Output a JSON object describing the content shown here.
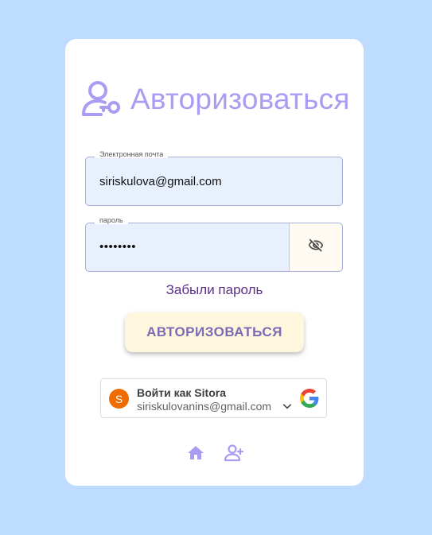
{
  "colors": {
    "page_background": "#bedcff",
    "card_background": "#ffffff",
    "accent": "#a89df3",
    "input_fill": "#e8f0fe",
    "button_fill": "#fff6de",
    "button_text": "#7a6bb5",
    "link_text": "#5a2f86"
  },
  "header": {
    "icon": "user-key-icon",
    "title": "Авторизоваться"
  },
  "form": {
    "email": {
      "label": "Электронная почта",
      "value": "siriskulova@gmail.com"
    },
    "password": {
      "label": "пароль",
      "value": "••••••••",
      "toggle_icon": "eye-off-icon"
    },
    "forgot_link": "Забыли пароль",
    "submit_label": "АВТОРИЗОВАТЬСЯ"
  },
  "google_signin": {
    "avatar_letter": "S",
    "title": "Войти как Sitora",
    "email": "siriskulovanins@gmail.com",
    "chevron_icon": "chevron-down-icon",
    "logo_icon": "google-logo-icon"
  },
  "footer": {
    "icons": [
      "home-icon",
      "add-user-icon"
    ]
  }
}
